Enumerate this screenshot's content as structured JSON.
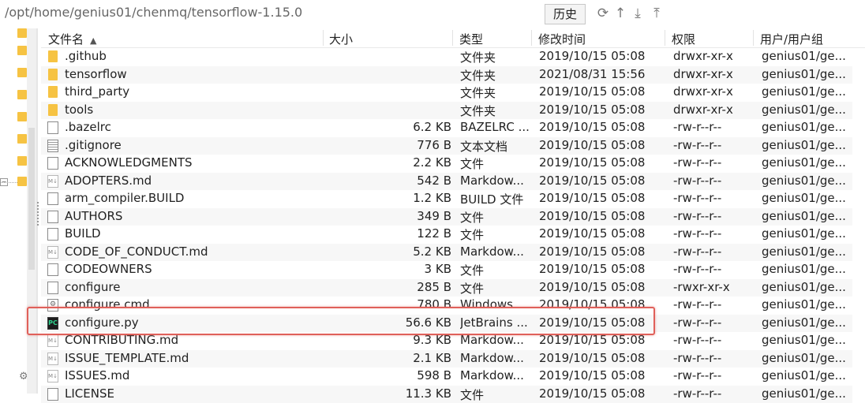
{
  "path_bar": {
    "path": "/opt/home/genius01/chenmq/tensorflow-1.15.0",
    "history_label": "历史"
  },
  "toolbar_icons": [
    "refresh-icon",
    "up-arrow-icon",
    "download-icon",
    "upload-icon"
  ],
  "columns": {
    "name": "文件名",
    "size": "大小",
    "type": "类型",
    "modified": "修改时间",
    "perm": "权限",
    "owner": "用户/用户组"
  },
  "files": [
    {
      "name": ".github",
      "size": "",
      "type": "文件夹",
      "modified": "2019/10/15 05:08",
      "perm": "drwxr-xr-x",
      "owner": "genius01/ge...",
      "icon": "folder"
    },
    {
      "name": "tensorflow",
      "size": "",
      "type": "文件夹",
      "modified": "2021/08/31 15:56",
      "perm": "drwxr-xr-x",
      "owner": "genius01/ge...",
      "icon": "folder"
    },
    {
      "name": "third_party",
      "size": "",
      "type": "文件夹",
      "modified": "2019/10/15 05:08",
      "perm": "drwxr-xr-x",
      "owner": "genius01/ge...",
      "icon": "folder"
    },
    {
      "name": "tools",
      "size": "",
      "type": "文件夹",
      "modified": "2019/10/15 05:08",
      "perm": "drwxr-xr-x",
      "owner": "genius01/ge...",
      "icon": "folder"
    },
    {
      "name": ".bazelrc",
      "size": "6.2 KB",
      "type": "BAZELRC ...",
      "modified": "2019/10/15 05:08",
      "perm": "-rw-r--r--",
      "owner": "genius01/ge...",
      "icon": "file"
    },
    {
      "name": ".gitignore",
      "size": "776 B",
      "type": "文本文档",
      "modified": "2019/10/15 05:08",
      "perm": "-rw-r--r--",
      "owner": "genius01/ge...",
      "icon": "text"
    },
    {
      "name": "ACKNOWLEDGMENTS",
      "size": "2.2 KB",
      "type": "文件",
      "modified": "2019/10/15 05:08",
      "perm": "-rw-r--r--",
      "owner": "genius01/ge...",
      "icon": "file"
    },
    {
      "name": "ADOPTERS.md",
      "size": "542 B",
      "type": "Markdow...",
      "modified": "2019/10/15 05:08",
      "perm": "-rw-r--r--",
      "owner": "genius01/ge...",
      "icon": "md"
    },
    {
      "name": "arm_compiler.BUILD",
      "size": "1.2 KB",
      "type": "BUILD 文件",
      "modified": "2019/10/15 05:08",
      "perm": "-rw-r--r--",
      "owner": "genius01/ge...",
      "icon": "file"
    },
    {
      "name": "AUTHORS",
      "size": "349 B",
      "type": "文件",
      "modified": "2019/10/15 05:08",
      "perm": "-rw-r--r--",
      "owner": "genius01/ge...",
      "icon": "file"
    },
    {
      "name": "BUILD",
      "size": "122 B",
      "type": "文件",
      "modified": "2019/10/15 05:08",
      "perm": "-rw-r--r--",
      "owner": "genius01/ge...",
      "icon": "file"
    },
    {
      "name": "CODE_OF_CONDUCT.md",
      "size": "5.2 KB",
      "type": "Markdow...",
      "modified": "2019/10/15 05:08",
      "perm": "-rw-r--r--",
      "owner": "genius01/ge...",
      "icon": "md"
    },
    {
      "name": "CODEOWNERS",
      "size": "3 KB",
      "type": "文件",
      "modified": "2019/10/15 05:08",
      "perm": "-rw-r--r--",
      "owner": "genius01/ge...",
      "icon": "file"
    },
    {
      "name": "configure",
      "size": "285 B",
      "type": "文件",
      "modified": "2019/10/15 05:08",
      "perm": "-rwxr-xr-x",
      "owner": "genius01/ge...",
      "icon": "file"
    },
    {
      "name": "configure.cmd",
      "size": "780 B",
      "type": "Windows ...",
      "modified": "2019/10/15 05:08",
      "perm": "-rw-r--r--",
      "owner": "genius01/ge...",
      "icon": "cmd"
    },
    {
      "name": "configure.py",
      "size": "56.6 KB",
      "type": "JetBrains ...",
      "modified": "2019/10/15 05:08",
      "perm": "-rw-r--r--",
      "owner": "genius01/ge...",
      "icon": "pyc"
    },
    {
      "name": "CONTRIBUTING.md",
      "size": "9.3 KB",
      "type": "Markdow...",
      "modified": "2019/10/15 05:08",
      "perm": "-rw-r--r--",
      "owner": "genius01/ge...",
      "icon": "md"
    },
    {
      "name": "ISSUE_TEMPLATE.md",
      "size": "2.1 KB",
      "type": "Markdow...",
      "modified": "2019/10/15 05:08",
      "perm": "-rw-r--r--",
      "owner": "genius01/ge...",
      "icon": "md"
    },
    {
      "name": "ISSUES.md",
      "size": "598 B",
      "type": "Markdow...",
      "modified": "2019/10/15 05:08",
      "perm": "-rw-r--r--",
      "owner": "genius01/ge...",
      "icon": "md"
    },
    {
      "name": "LICENSE",
      "size": "11.3 KB",
      "type": "文件",
      "modified": "2019/10/15 05:08",
      "perm": "-rw-r--r--",
      "owner": "genius01/ge...",
      "icon": "file"
    }
  ],
  "highlighted_file": "configure.py"
}
